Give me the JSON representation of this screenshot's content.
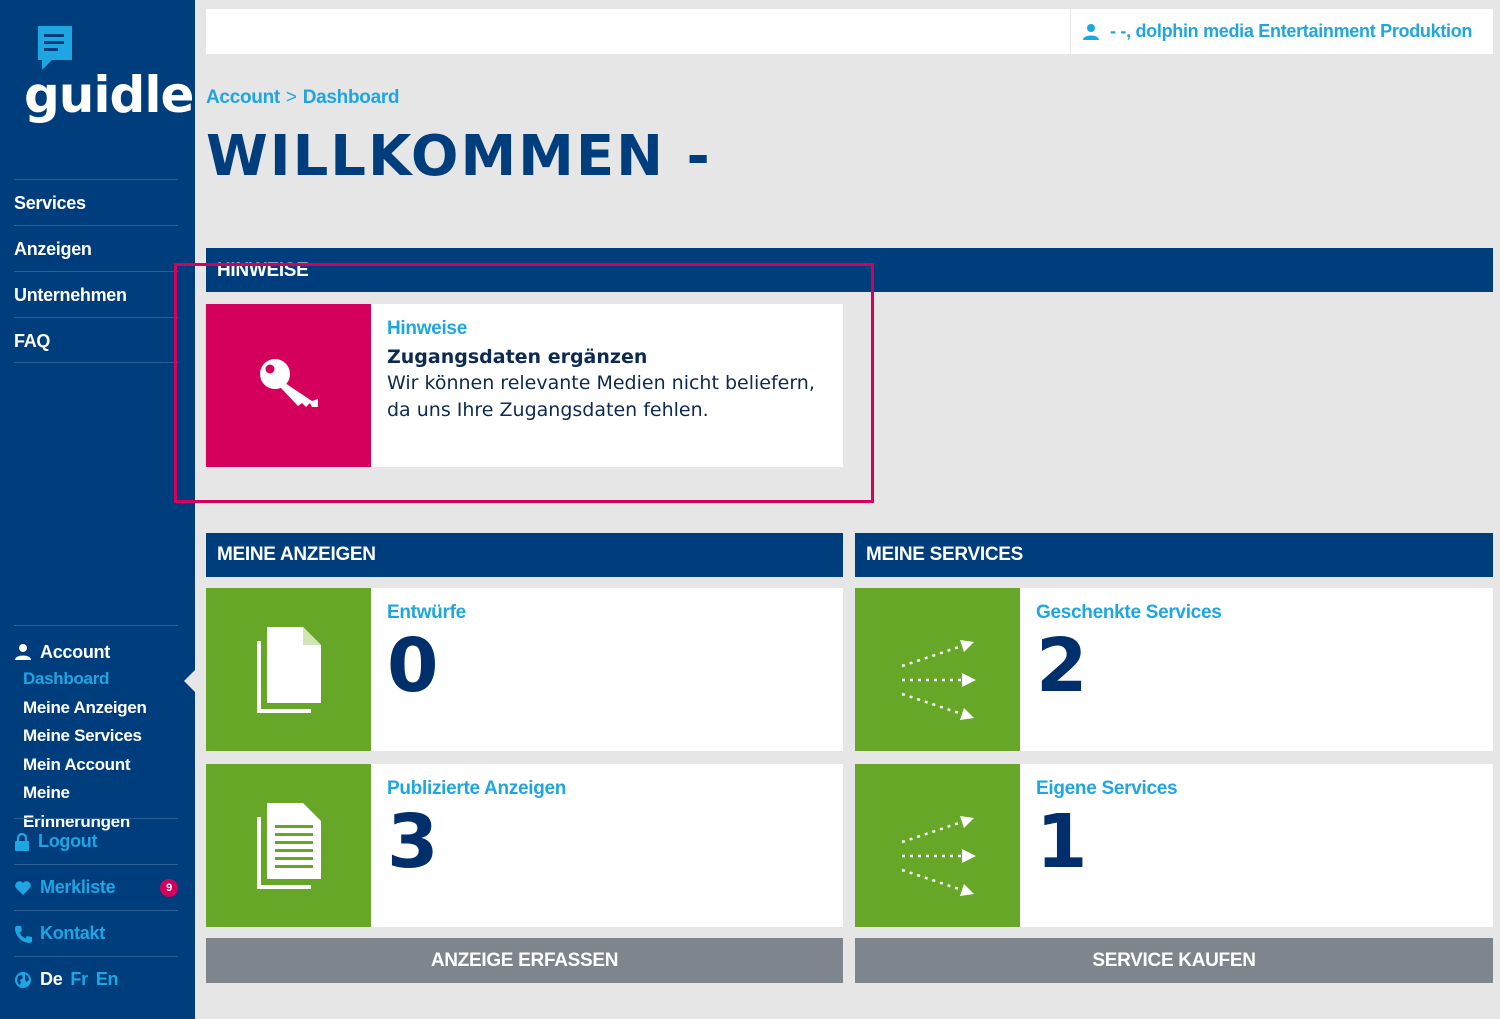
{
  "brand": {
    "name": "guidle",
    "logo_icon": "speech-bubble-icon"
  },
  "sidebar": {
    "main_nav": [
      {
        "label": "Services"
      },
      {
        "label": "Anzeigen"
      },
      {
        "label": "Unternehmen"
      },
      {
        "label": "FAQ"
      }
    ],
    "account": {
      "label": "Account",
      "icon": "user-icon",
      "items": [
        {
          "label": "Dashboard",
          "active": true
        },
        {
          "label": "Meine Anzeigen"
        },
        {
          "label": "Meine Services"
        },
        {
          "label": "Mein Account"
        },
        {
          "label": "Meine Erinnerungen"
        }
      ]
    },
    "logout": {
      "label": "Logout",
      "icon": "lock-icon"
    },
    "merkliste": {
      "label": "Merkliste",
      "icon": "heart-icon",
      "count": "9"
    },
    "kontakt": {
      "label": "Kontakt",
      "icon": "phone-icon"
    },
    "languages": {
      "icon": "globe-icon",
      "items": [
        "De",
        "Fr",
        "En"
      ],
      "current": "De"
    }
  },
  "topbar": {
    "user": "- -, dolphin media Entertainment Produktion"
  },
  "breadcrumb": {
    "items": [
      "Account",
      "Dashboard"
    ],
    "separator": ">"
  },
  "page_title": "WILLKOMMEN -",
  "hints": {
    "header": "HINWEISE",
    "card": {
      "label": "Hinweise",
      "title": "Zugangsdaten ergänzen",
      "text": "Wir können relevante Medien nicht beliefern, da uns Ihre Zugangsdaten fehlen.",
      "icon": "key-icon"
    }
  },
  "meine_anzeigen": {
    "header": "MEINE ANZEIGEN",
    "drafts": {
      "label": "Entwürfe",
      "value": "0",
      "icon": "document-icon"
    },
    "published": {
      "label": "Publizierte Anzeigen",
      "value": "3",
      "icon": "document-lines-icon"
    },
    "action": "ANZEIGE ERFASSEN"
  },
  "meine_services": {
    "header": "MEINE SERVICES",
    "gifted": {
      "label": "Geschenkte Services",
      "value": "2",
      "icon": "share-arrows-icon"
    },
    "own": {
      "label": "Eigene Services",
      "value": "1",
      "icon": "share-arrows-icon"
    },
    "action": "SERVICE KAUFEN"
  },
  "colors": {
    "navy": "#003d7d",
    "accent_blue": "#1ea6e3",
    "pink": "#d4005c",
    "green": "#66a727",
    "button_gray": "#7e858d",
    "background": "#e6e6e6"
  }
}
